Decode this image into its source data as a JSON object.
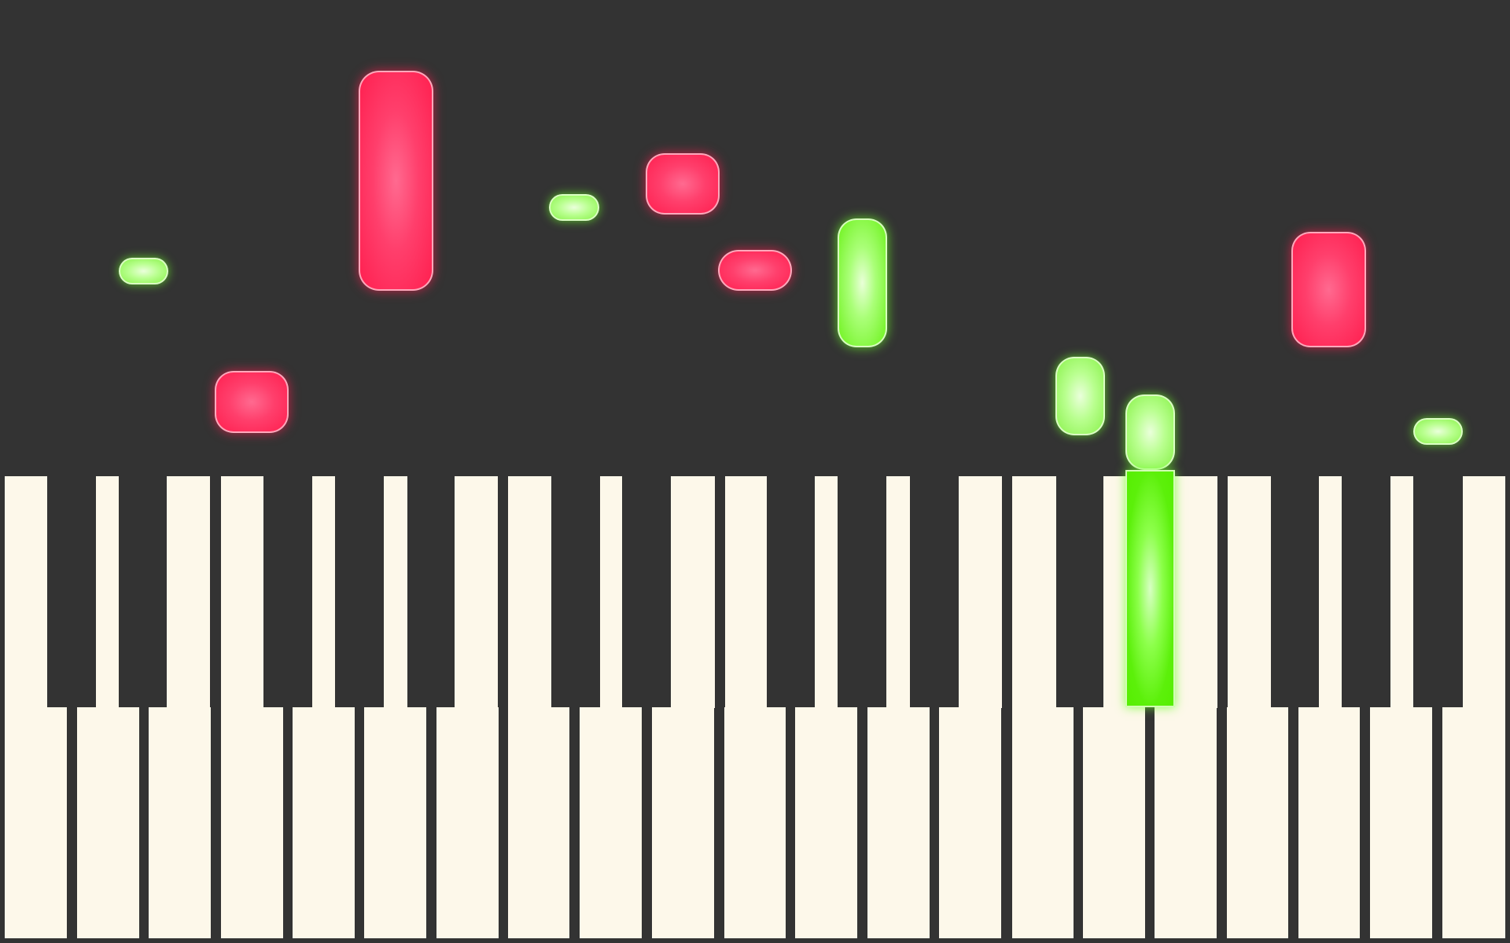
{
  "app": {
    "background": "#333333",
    "white_key_color": "#fdf8ea",
    "black_key_color": "#333333",
    "note_colors": {
      "right_hand": "#ff2d5a",
      "left_hand": "#66f015"
    }
  },
  "keyboard": {
    "white_key_count": 21,
    "black_key_count": 15,
    "pressed_keys": [
      {
        "name": "key-black-pressed",
        "hand": "left_hand"
      }
    ]
  },
  "falling_notes": [
    {
      "name": "note-green-1",
      "hand": "left_hand"
    },
    {
      "name": "note-red-1",
      "hand": "right_hand"
    },
    {
      "name": "note-red-2",
      "hand": "right_hand"
    },
    {
      "name": "note-green-2",
      "hand": "left_hand"
    },
    {
      "name": "note-red-3",
      "hand": "right_hand"
    },
    {
      "name": "note-red-4",
      "hand": "right_hand"
    },
    {
      "name": "note-green-3",
      "hand": "left_hand"
    },
    {
      "name": "note-green-4",
      "hand": "left_hand"
    },
    {
      "name": "note-green-5",
      "hand": "left_hand"
    },
    {
      "name": "note-red-5",
      "hand": "right_hand"
    },
    {
      "name": "note-green-6",
      "hand": "left_hand"
    }
  ]
}
